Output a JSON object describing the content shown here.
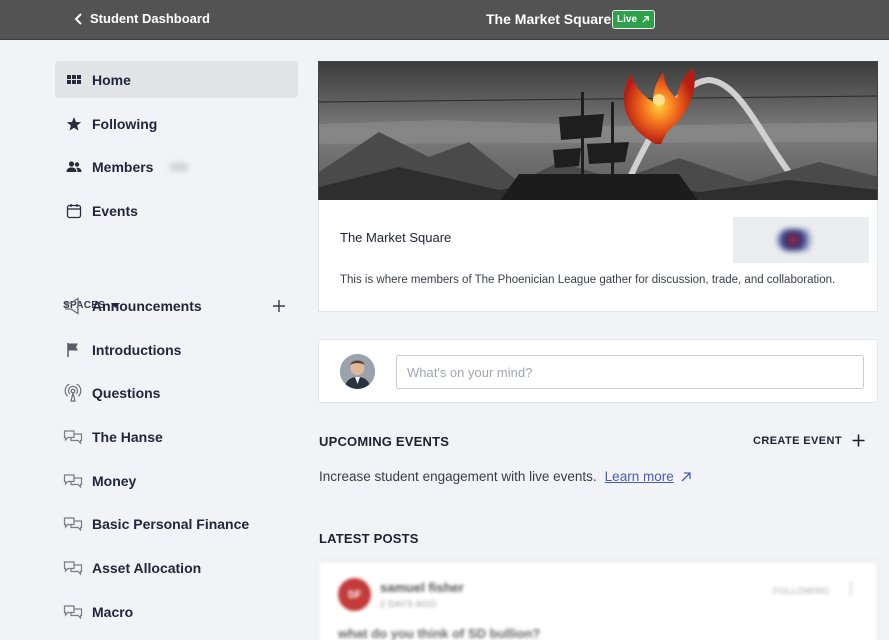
{
  "topbar": {
    "back_label": "Student Dashboard",
    "title": "The Market Square",
    "live_badge": "Live"
  },
  "sidebar": {
    "nav": [
      {
        "label": "Home",
        "icon": "grid-icon",
        "active": true
      },
      {
        "label": "Following",
        "icon": "star-icon"
      },
      {
        "label": "Members",
        "icon": "people-icon"
      },
      {
        "label": "Events",
        "icon": "calendar-icon"
      }
    ],
    "spaces_heading": "SPACES",
    "spaces": [
      {
        "label": "Announcements",
        "icon": "megaphone-icon"
      },
      {
        "label": "Introductions",
        "icon": "flag-icon"
      },
      {
        "label": "Questions",
        "icon": "broadcast-icon"
      },
      {
        "label": "The Hanse",
        "icon": "chat-bubbles-icon"
      },
      {
        "label": "Money",
        "icon": "chat-bubbles-icon"
      },
      {
        "label": "Basic Personal Finance",
        "icon": "chat-bubbles-icon"
      },
      {
        "label": "Asset Allocation",
        "icon": "chat-bubbles-icon"
      },
      {
        "label": "Macro",
        "icon": "chat-bubbles-icon"
      }
    ]
  },
  "community": {
    "name": "The Market Square",
    "description": "This is where members of The Phoenician League gather for discussion, trade, and collaboration."
  },
  "composer": {
    "placeholder": "What's on your mind?"
  },
  "events": {
    "heading": "UPCOMING EVENTS",
    "create_label": "CREATE EVENT",
    "text": "Increase student engagement with live events.",
    "link": "Learn more"
  },
  "posts": {
    "heading": "LATEST POSTS",
    "items": [
      {
        "initials": "SF",
        "author": "samuel fisher",
        "time": "2 DAYS AGO",
        "follow": "FOLLOWING",
        "title": "what do you think of SD bullion?"
      }
    ]
  },
  "colors": {
    "topbar": "#535353",
    "live_badge": "#2ea04a",
    "link": "#4a5bb8",
    "background": "#f2f3f6"
  }
}
